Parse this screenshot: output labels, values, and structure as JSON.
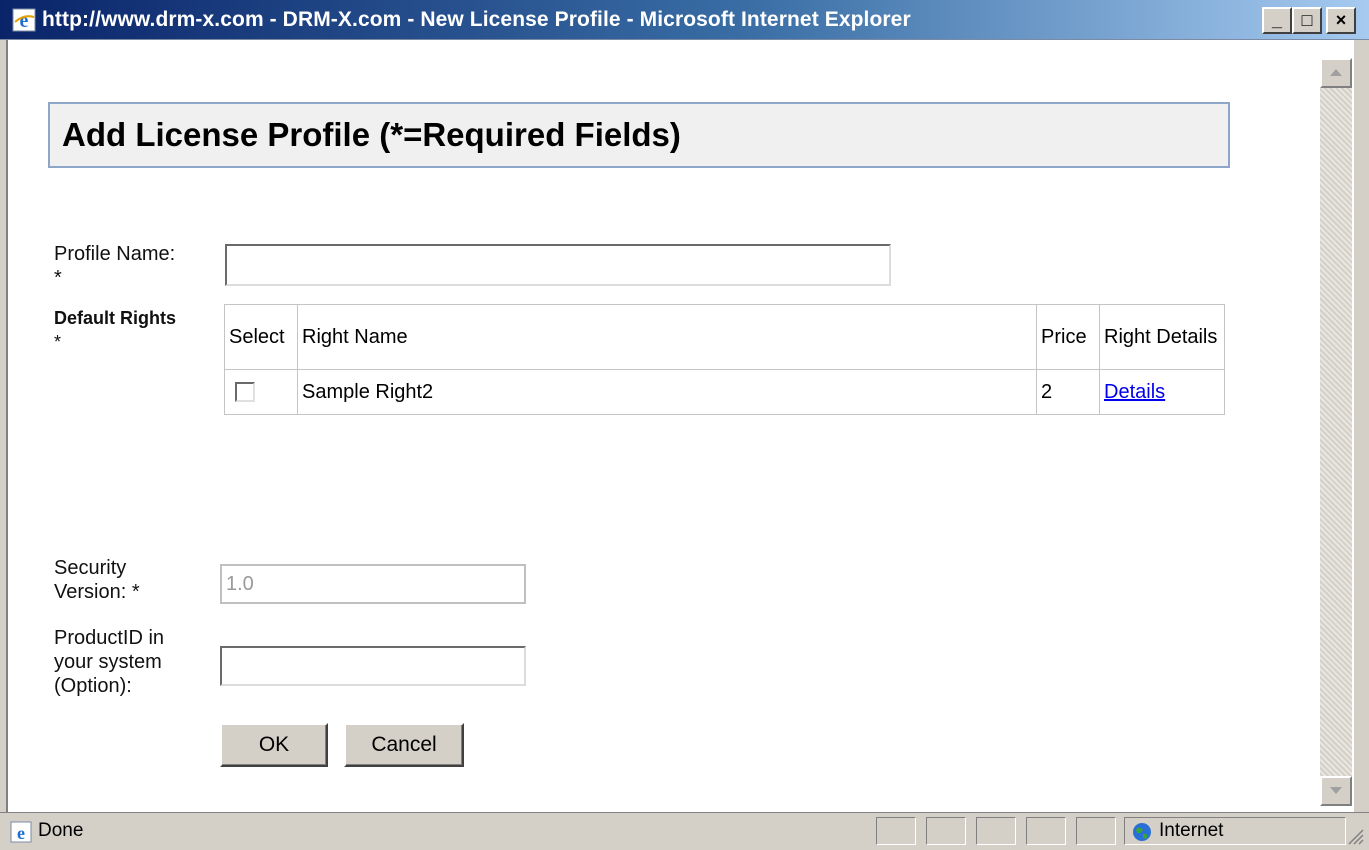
{
  "window": {
    "title": "http://www.drm-x.com - DRM-X.com - New License Profile - Microsoft Internet Explorer",
    "minimize": "_",
    "maximize": "□",
    "close": "×"
  },
  "page": {
    "title": "Add License Profile (*=Required Fields)"
  },
  "form": {
    "profile_name_label": "Profile Name:",
    "profile_name_required": "*",
    "profile_name_value": "",
    "default_rights_label": "Default Rights",
    "default_rights_required": "*",
    "rights_table": {
      "headers": {
        "select": "Select",
        "right_name": "Right Name",
        "price": "Price",
        "right_details": "Right Details"
      },
      "rows": [
        {
          "selected": false,
          "right_name": "Sample Right2",
          "price": "2",
          "details_link": "Details"
        }
      ]
    },
    "security_version_label": "Security Version: *",
    "security_version_value": "1.0",
    "product_id_label": "ProductID in your system (Option):",
    "product_id_value": "",
    "ok_label": "OK",
    "cancel_label": "Cancel"
  },
  "statusbar": {
    "status": "Done",
    "zone": "Internet"
  },
  "colors": {
    "titlebar_start": "#0a246a",
    "titlebar_end": "#a6caf0",
    "chrome": "#d4d0c8",
    "link": "#0000ee",
    "title_box_border": "#8ea6c7"
  }
}
